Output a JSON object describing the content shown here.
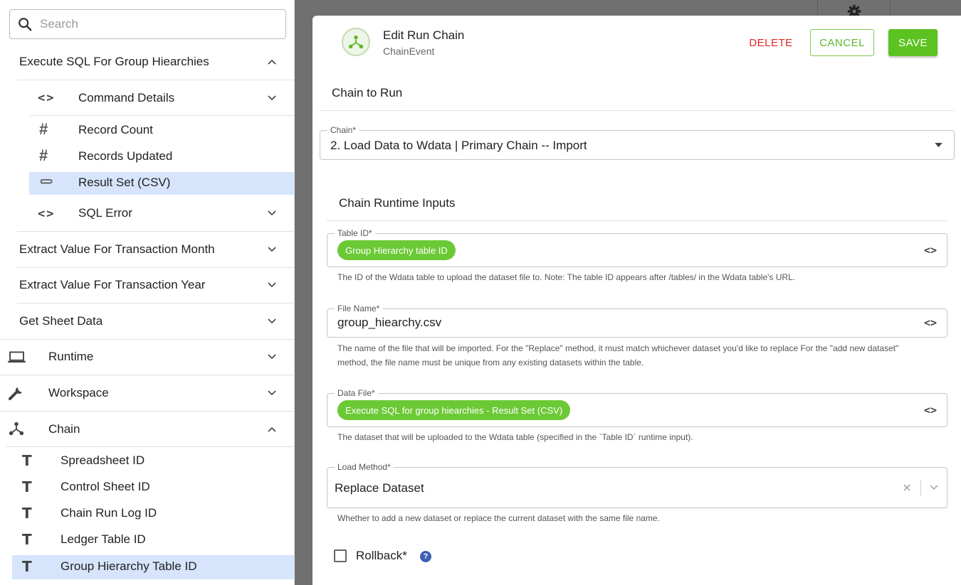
{
  "search": {
    "placeholder": "Search"
  },
  "tree": {
    "group1": {
      "label": "Execute SQL For Group Hiearchies",
      "children": [
        {
          "label": "Command Details",
          "icon": "code-icon"
        },
        {
          "label": "Record Count",
          "icon": "hash-icon"
        },
        {
          "label": "Records Updated",
          "icon": "hash-icon"
        },
        {
          "label": "Result Set (CSV)",
          "icon": "paperclip-icon"
        },
        {
          "label": "SQL Error",
          "icon": "code-icon"
        }
      ]
    },
    "items": [
      {
        "label": "Extract Value For Transaction Month"
      },
      {
        "label": "Extract Value For Transaction Year"
      },
      {
        "label": "Get Sheet Data"
      }
    ],
    "runtime": {
      "label": "Runtime",
      "icon": "laptop-icon"
    },
    "workspace": {
      "label": "Workspace",
      "icon": "wrench-icon"
    },
    "chain": {
      "label": "Chain",
      "icon": "chain-icon",
      "children": [
        {
          "label": "Spreadsheet ID"
        },
        {
          "label": "Control Sheet ID"
        },
        {
          "label": "Chain Run Log ID"
        },
        {
          "label": "Ledger Table ID"
        },
        {
          "label": "Group Hierarchy Table ID"
        }
      ]
    }
  },
  "dialog": {
    "title": "Edit Run Chain",
    "subtitle": "ChainEvent",
    "delete_label": "DELETE",
    "cancel_label": "CANCEL",
    "save_label": "SAVE",
    "section_chain": "Chain to Run",
    "chain_field": {
      "label": "Chain*",
      "value": "2. Load Data to Wdata | Primary Chain -- Import"
    },
    "section_inputs": "Chain Runtime Inputs",
    "table_id": {
      "label": "Table ID*",
      "chip": "Group Hierarchy table ID",
      "help": "The ID of the Wdata table to upload the dataset file to. Note: The table ID appears after /tables/ in the Wdata table's URL."
    },
    "file_name": {
      "label": "File Name*",
      "value": "group_hiearchy.csv",
      "help": "The name of the file that will be imported. For the \"Replace\" method, it must match whichever dataset you'd like to replace For the \"add new dataset\" method, the file name must be unique from any existing datasets within the table."
    },
    "data_file": {
      "label": "Data File*",
      "chip": "Execute SQL for group hiearchies - Result Set (CSV)",
      "help": "The dataset that will be uploaded to the Wdata table (specified in the `Table ID` runtime input)."
    },
    "load_method": {
      "label": "Load Method*",
      "value": "Replace Dataset",
      "help": "Whether to add a new dataset or replace the current dataset with the same file name."
    },
    "rollback": {
      "label": "Rollback*",
      "help_icon": "?"
    }
  },
  "colors": {
    "accent_green": "#5cc21f",
    "chip_green": "#6cc936",
    "delete_red": "#e0251f",
    "selection_blue": "#d6e5fb",
    "help_blue": "#3d5fb5"
  }
}
